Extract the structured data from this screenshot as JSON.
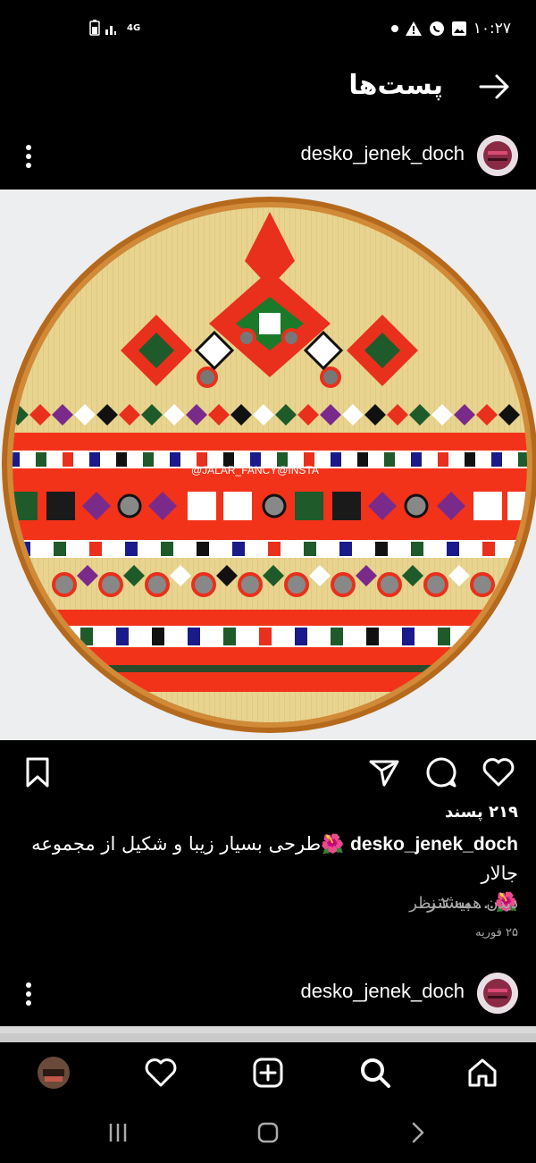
{
  "status_bar": {
    "time": "۱۰:۲۷",
    "network": "4G"
  },
  "header": {
    "title": "پست‌ها"
  },
  "post": {
    "username": "desko_jenek_doch",
    "image_watermark": "@JALAR_FANCY@INSTA",
    "likes": "۲۱۹ پسند",
    "caption_user": "desko_jenek_doch",
    "caption_text": "🌺طرحی بسیار زیبا و شکیل از مجموعه جالار",
    "caption_more": "🌺... بیشتر",
    "view_comments": "دیدن همه ۲ نظر",
    "date": "۲۵ فوریه"
  },
  "next_post": {
    "username": "desko_jenek_doch"
  },
  "icons": {
    "more": "more-vertical-icon",
    "back": "arrow-right-icon",
    "save": "bookmark-icon",
    "share": "send-icon",
    "comment": "comment-icon",
    "like": "heart-icon"
  },
  "colors": {
    "background": "#000000",
    "text": "#ffffff",
    "secondary_text": "#a8a8a8"
  }
}
